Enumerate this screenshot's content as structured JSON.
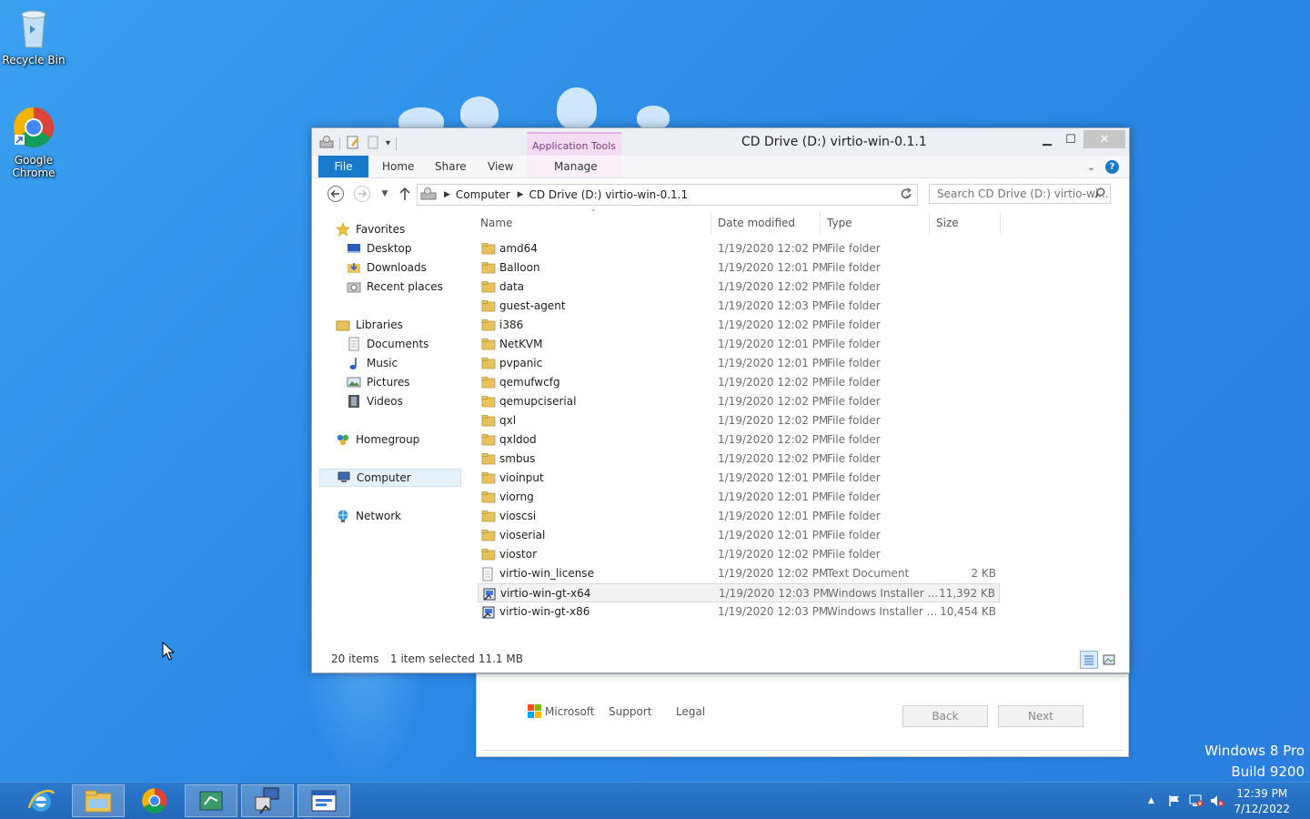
{
  "desktop": {
    "icons": [
      {
        "label": "Recycle Bin",
        "icon": "recycle-bin-icon"
      },
      {
        "label": "Google Chrome",
        "icon": "chrome-icon"
      }
    ],
    "watermark": {
      "line1": "Windows 8 Pro",
      "line2": "Build 9200"
    }
  },
  "installer": {
    "brand": "Microsoft",
    "links": [
      "Support",
      "Legal"
    ],
    "back_label": "Back",
    "next_label": "Next"
  },
  "explorer": {
    "title": "CD Drive (D:) virtio-win-0.1.1",
    "contextual_tab_group": "Application Tools",
    "ribbon_tabs": [
      "File",
      "Home",
      "Share",
      "View",
      "Manage"
    ],
    "breadcrumb": [
      "Computer",
      "CD Drive (D:) virtio-win-0.1.1"
    ],
    "search_placeholder": "Search CD Drive (D:) virtio-wi...",
    "nav": {
      "favorites": "Favorites",
      "desktop": "Desktop",
      "downloads": "Downloads",
      "recent": "Recent places",
      "libraries": "Libraries",
      "documents": "Documents",
      "music": "Music",
      "pictures": "Pictures",
      "videos": "Videos",
      "homegroup": "Homegroup",
      "computer": "Computer",
      "network": "Network"
    },
    "columns": {
      "name": "Name",
      "date": "Date modified",
      "type": "Type",
      "size": "Size"
    },
    "files": [
      {
        "name": "amd64",
        "date": "1/19/2020 12:02 PM",
        "type": "File folder",
        "size": "",
        "kind": "folder"
      },
      {
        "name": "Balloon",
        "date": "1/19/2020 12:01 PM",
        "type": "File folder",
        "size": "",
        "kind": "folder"
      },
      {
        "name": "data",
        "date": "1/19/2020 12:02 PM",
        "type": "File folder",
        "size": "",
        "kind": "folder"
      },
      {
        "name": "guest-agent",
        "date": "1/19/2020 12:03 PM",
        "type": "File folder",
        "size": "",
        "kind": "folder"
      },
      {
        "name": "i386",
        "date": "1/19/2020 12:02 PM",
        "type": "File folder",
        "size": "",
        "kind": "folder"
      },
      {
        "name": "NetKVM",
        "date": "1/19/2020 12:01 PM",
        "type": "File folder",
        "size": "",
        "kind": "folder"
      },
      {
        "name": "pvpanic",
        "date": "1/19/2020 12:01 PM",
        "type": "File folder",
        "size": "",
        "kind": "folder"
      },
      {
        "name": "qemufwcfg",
        "date": "1/19/2020 12:02 PM",
        "type": "File folder",
        "size": "",
        "kind": "folder"
      },
      {
        "name": "qemupciserial",
        "date": "1/19/2020 12:02 PM",
        "type": "File folder",
        "size": "",
        "kind": "folder"
      },
      {
        "name": "qxl",
        "date": "1/19/2020 12:02 PM",
        "type": "File folder",
        "size": "",
        "kind": "folder"
      },
      {
        "name": "qxldod",
        "date": "1/19/2020 12:02 PM",
        "type": "File folder",
        "size": "",
        "kind": "folder"
      },
      {
        "name": "smbus",
        "date": "1/19/2020 12:02 PM",
        "type": "File folder",
        "size": "",
        "kind": "folder"
      },
      {
        "name": "vioinput",
        "date": "1/19/2020 12:01 PM",
        "type": "File folder",
        "size": "",
        "kind": "folder"
      },
      {
        "name": "viorng",
        "date": "1/19/2020 12:01 PM",
        "type": "File folder",
        "size": "",
        "kind": "folder"
      },
      {
        "name": "vioscsi",
        "date": "1/19/2020 12:01 PM",
        "type": "File folder",
        "size": "",
        "kind": "folder"
      },
      {
        "name": "vioserial",
        "date": "1/19/2020 12:01 PM",
        "type": "File folder",
        "size": "",
        "kind": "folder"
      },
      {
        "name": "viostor",
        "date": "1/19/2020 12:02 PM",
        "type": "File folder",
        "size": "",
        "kind": "folder"
      },
      {
        "name": "virtio-win_license",
        "date": "1/19/2020 12:02 PM",
        "type": "Text Document",
        "size": "2 KB",
        "kind": "text"
      },
      {
        "name": "virtio-win-gt-x64",
        "date": "1/19/2020 12:03 PM",
        "type": "Windows Installer ...",
        "size": "11,392 KB",
        "kind": "msi",
        "selected": true
      },
      {
        "name": "virtio-win-gt-x86",
        "date": "1/19/2020 12:03 PM",
        "type": "Windows Installer ...",
        "size": "10,454 KB",
        "kind": "msi"
      }
    ],
    "status": {
      "count": "20 items",
      "selection": "1 item selected  11.1 MB"
    }
  },
  "taskbar": {
    "time": "12:39 PM",
    "date": "7/12/2022"
  },
  "colors": {
    "accent": "#1979ca",
    "folder": "#e8c25a",
    "desktop": "#2d8ae6"
  }
}
